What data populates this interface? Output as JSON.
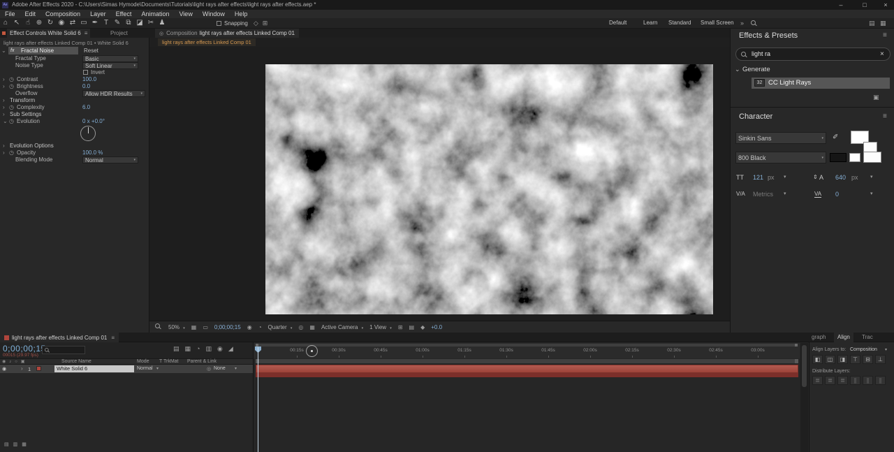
{
  "glyphs": {
    "hamburger": "≡",
    "close": "×",
    "caret": "▾",
    "chev_right": "›",
    "chev_down": "⌄",
    "stopwatch": "◷",
    "panel": "▣",
    "lock": "◎",
    "eye": "◉",
    "pickwhip": "◎",
    "overflow": "»"
  },
  "window": {
    "app_badge": "Ae",
    "title": "Adobe After Effects 2020 - C:\\Users\\Simas Hymode\\Documents\\Tutorials\\light rays after effects\\light rays after effects.aep *",
    "minimize": "–",
    "maximize": "□",
    "close": "×"
  },
  "menubar": {
    "items": [
      "File",
      "Edit",
      "Composition",
      "Layer",
      "Effect",
      "Animation",
      "View",
      "Window",
      "Help"
    ]
  },
  "toolbar": {
    "tools": [
      {
        "name": "home",
        "glyph": "⌂"
      },
      {
        "name": "selection",
        "glyph": "↖"
      },
      {
        "name": "hand",
        "glyph": "☝"
      },
      {
        "name": "zoom",
        "glyph": "⊕"
      },
      {
        "name": "orbit",
        "glyph": "↻"
      },
      {
        "name": "camera",
        "glyph": "◉"
      },
      {
        "name": "pan-behind",
        "glyph": "⇄"
      },
      {
        "name": "shape",
        "glyph": "▭"
      },
      {
        "name": "pen",
        "glyph": "✒"
      },
      {
        "name": "type",
        "glyph": "T"
      },
      {
        "name": "brush",
        "glyph": "✎"
      },
      {
        "name": "clone-stamp",
        "glyph": "⧉"
      },
      {
        "name": "eraser",
        "glyph": "◪"
      },
      {
        "name": "roto-brush",
        "glyph": "✂"
      },
      {
        "name": "puppet-pin",
        "glyph": "♟"
      }
    ],
    "snapping_label": "Snapping",
    "snap_icons": [
      {
        "name": "snap-shape",
        "glyph": "◇"
      },
      {
        "name": "snap-grid",
        "glyph": "⊞"
      }
    ],
    "workspaces": [
      "Default",
      "Learn",
      "Standard",
      "Small Screen"
    ],
    "overflow": "»",
    "right_icons": [
      {
        "name": "workspace-panels",
        "glyph": "▤"
      },
      {
        "name": "workspace-layout",
        "glyph": "▦"
      }
    ]
  },
  "effect_controls": {
    "tab_active": "Effect Controls White Solid 6",
    "tab_inactive": "Project",
    "breadcrumb": "light rays after effects Linked Comp 01 • White Solid 6",
    "effect_badge": "fx",
    "effect_name": "Fractal Noise",
    "reset_label": "Reset",
    "rows": [
      {
        "label": "Fractal Type",
        "value": "Basic"
      },
      {
        "label": "Noise Type",
        "value": "Soft Linear"
      },
      {
        "label": "Invert",
        "value": ""
      },
      {
        "label": "Contrast",
        "value": "100.0"
      },
      {
        "label": "Brightness",
        "value": "0.0"
      },
      {
        "label": "Overflow",
        "value": "Allow HDR Results"
      },
      {
        "label": "Transform",
        "value": ""
      },
      {
        "label": "Complexity",
        "value": "6.0"
      },
      {
        "label": "Sub Settings",
        "value": ""
      },
      {
        "label": "Evolution",
        "value": "0 x +0.0°"
      },
      {
        "label": "Evolution Options",
        "value": ""
      },
      {
        "label": "Opacity",
        "value": "100.0 %"
      },
      {
        "label": "Blending Mode",
        "value": "Normal"
      }
    ]
  },
  "composition": {
    "tab_prefix": "Composition",
    "tab_name": "light rays after effects Linked Comp 01",
    "navigator_name": "light rays after effects Linked Comp 01",
    "toolbar": {
      "zoom": "50%",
      "time": "0;00;00;15",
      "resolution": "Quarter",
      "camera": "Active Camera",
      "views": "1 View",
      "exposure": "+0.0"
    },
    "icons": [
      {
        "name": "grid-and-guides",
        "glyph": "▦"
      },
      {
        "name": "mask-visibility",
        "glyph": "▭"
      },
      {
        "name": "snapshot-camera",
        "glyph": "◉"
      },
      {
        "name": "show-snapshot",
        "glyph": "◔"
      },
      {
        "name": "region-of-interest",
        "glyph": "◎"
      },
      {
        "name": "transparency-grid",
        "glyph": "▦"
      },
      {
        "name": "pixel-aspect",
        "glyph": "⊞"
      },
      {
        "name": "fast-previews",
        "glyph": "▤"
      },
      {
        "name": "refresh-view",
        "glyph": "◆"
      }
    ]
  },
  "effects_presets": {
    "title": "Effects & Presets",
    "search_value": "light ra",
    "group_label": "Generate",
    "result_badge": "32",
    "result_label": "CC Light Rays"
  },
  "character": {
    "title": "Character",
    "font_family": "Sinkin Sans",
    "font_style": "800 Black",
    "size_icon": "TT",
    "font_size": "121",
    "font_size_unit": "px",
    "leading_arrow": "⇕",
    "leading_icon": "A",
    "leading": "640",
    "leading_unit": "px",
    "kerning_icon": "V/A",
    "kerning_value": "Metrics",
    "tracking_icon": "VA",
    "tracking_value": "0"
  },
  "timeline": {
    "tab": "light rays after effects Linked Comp 01",
    "current_time": "0;00;00;15",
    "frame_info": "00015 (29.97 fps)",
    "icons": [
      {
        "name": "composition-mini-flowchart",
        "glyph": "▤"
      },
      {
        "name": "draft-3d",
        "glyph": "▦"
      },
      {
        "name": "hide-shy-layers",
        "glyph": "◔"
      },
      {
        "name": "frame-blending",
        "glyph": "▥"
      },
      {
        "name": "motion-blur",
        "glyph": "◉"
      },
      {
        "name": "graph-editor",
        "glyph": "◢"
      }
    ],
    "col_icons": [
      {
        "name": "video-column",
        "glyph": "◉"
      },
      {
        "name": "audio-column",
        "glyph": "♪"
      },
      {
        "name": "solo-column",
        "glyph": "○"
      },
      {
        "name": "lock-column",
        "glyph": "▣"
      }
    ],
    "columns": {
      "source_name": "Source Name",
      "mode": "Mode",
      "trkmat": "T TrkMat",
      "parent": "Parent & Link"
    },
    "layer": {
      "index": "1",
      "name": "White Solid 6",
      "mode": "Normal",
      "parent": "None"
    },
    "ruler": [
      "00:15s",
      "00:30s",
      "00:45s",
      "01:00s",
      "01:15s",
      "01:30s",
      "01:45s",
      "02:00s",
      "02:15s",
      "02:30s",
      "02:45s",
      "03:00s"
    ],
    "bottom_icons": [
      {
        "name": "expand-layer-switches",
        "glyph": "▤"
      },
      {
        "name": "expand-transfer-controls",
        "glyph": "▥"
      },
      {
        "name": "expand-in-out",
        "glyph": "▦"
      }
    ]
  },
  "align": {
    "tab_left": "graph",
    "tab_active": "Align",
    "tab_right": "Trac",
    "align_to_label": "Align Layers to:",
    "align_to_value": "Composition",
    "distribute_label": "Distribute Layers:",
    "align_icons": [
      {
        "name": "align-left",
        "glyph": "◧"
      },
      {
        "name": "align-center-horizontal",
        "glyph": "◫"
      },
      {
        "name": "align-right",
        "glyph": "◨"
      },
      {
        "name": "align-top",
        "glyph": "⊤"
      },
      {
        "name": "align-center-vertical",
        "glyph": "⊟"
      },
      {
        "name": "align-bottom",
        "glyph": "⊥"
      }
    ],
    "distribute_icons": [
      {
        "name": "distribute-top",
        "glyph": "≣"
      },
      {
        "name": "distribute-vertical-center",
        "glyph": "≣"
      },
      {
        "name": "distribute-bottom",
        "glyph": "≣"
      },
      {
        "name": "distribute-left",
        "glyph": "∥"
      },
      {
        "name": "distribute-horizontal-center",
        "glyph": "∥"
      },
      {
        "name": "distribute-right",
        "glyph": "∥"
      }
    ]
  }
}
